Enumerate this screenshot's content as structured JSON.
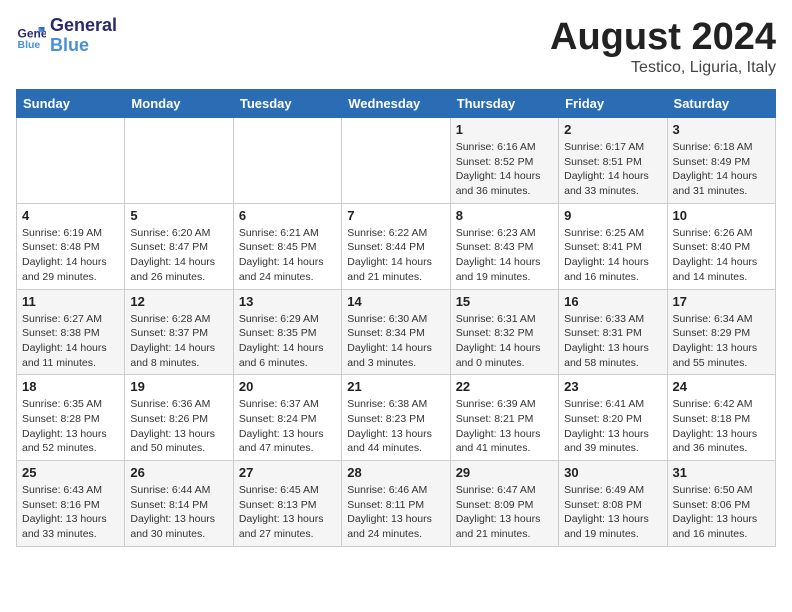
{
  "header": {
    "logo_line1": "General",
    "logo_line2": "Blue",
    "month_year": "August 2024",
    "location": "Testico, Liguria, Italy"
  },
  "weekdays": [
    "Sunday",
    "Monday",
    "Tuesday",
    "Wednesday",
    "Thursday",
    "Friday",
    "Saturday"
  ],
  "weeks": [
    [
      {
        "day": "",
        "info": ""
      },
      {
        "day": "",
        "info": ""
      },
      {
        "day": "",
        "info": ""
      },
      {
        "day": "",
        "info": ""
      },
      {
        "day": "1",
        "info": "Sunrise: 6:16 AM\nSunset: 8:52 PM\nDaylight: 14 hours and 36 minutes."
      },
      {
        "day": "2",
        "info": "Sunrise: 6:17 AM\nSunset: 8:51 PM\nDaylight: 14 hours and 33 minutes."
      },
      {
        "day": "3",
        "info": "Sunrise: 6:18 AM\nSunset: 8:49 PM\nDaylight: 14 hours and 31 minutes."
      }
    ],
    [
      {
        "day": "4",
        "info": "Sunrise: 6:19 AM\nSunset: 8:48 PM\nDaylight: 14 hours and 29 minutes."
      },
      {
        "day": "5",
        "info": "Sunrise: 6:20 AM\nSunset: 8:47 PM\nDaylight: 14 hours and 26 minutes."
      },
      {
        "day": "6",
        "info": "Sunrise: 6:21 AM\nSunset: 8:45 PM\nDaylight: 14 hours and 24 minutes."
      },
      {
        "day": "7",
        "info": "Sunrise: 6:22 AM\nSunset: 8:44 PM\nDaylight: 14 hours and 21 minutes."
      },
      {
        "day": "8",
        "info": "Sunrise: 6:23 AM\nSunset: 8:43 PM\nDaylight: 14 hours and 19 minutes."
      },
      {
        "day": "9",
        "info": "Sunrise: 6:25 AM\nSunset: 8:41 PM\nDaylight: 14 hours and 16 minutes."
      },
      {
        "day": "10",
        "info": "Sunrise: 6:26 AM\nSunset: 8:40 PM\nDaylight: 14 hours and 14 minutes."
      }
    ],
    [
      {
        "day": "11",
        "info": "Sunrise: 6:27 AM\nSunset: 8:38 PM\nDaylight: 14 hours and 11 minutes."
      },
      {
        "day": "12",
        "info": "Sunrise: 6:28 AM\nSunset: 8:37 PM\nDaylight: 14 hours and 8 minutes."
      },
      {
        "day": "13",
        "info": "Sunrise: 6:29 AM\nSunset: 8:35 PM\nDaylight: 14 hours and 6 minutes."
      },
      {
        "day": "14",
        "info": "Sunrise: 6:30 AM\nSunset: 8:34 PM\nDaylight: 14 hours and 3 minutes."
      },
      {
        "day": "15",
        "info": "Sunrise: 6:31 AM\nSunset: 8:32 PM\nDaylight: 14 hours and 0 minutes."
      },
      {
        "day": "16",
        "info": "Sunrise: 6:33 AM\nSunset: 8:31 PM\nDaylight: 13 hours and 58 minutes."
      },
      {
        "day": "17",
        "info": "Sunrise: 6:34 AM\nSunset: 8:29 PM\nDaylight: 13 hours and 55 minutes."
      }
    ],
    [
      {
        "day": "18",
        "info": "Sunrise: 6:35 AM\nSunset: 8:28 PM\nDaylight: 13 hours and 52 minutes."
      },
      {
        "day": "19",
        "info": "Sunrise: 6:36 AM\nSunset: 8:26 PM\nDaylight: 13 hours and 50 minutes."
      },
      {
        "day": "20",
        "info": "Sunrise: 6:37 AM\nSunset: 8:24 PM\nDaylight: 13 hours and 47 minutes."
      },
      {
        "day": "21",
        "info": "Sunrise: 6:38 AM\nSunset: 8:23 PM\nDaylight: 13 hours and 44 minutes."
      },
      {
        "day": "22",
        "info": "Sunrise: 6:39 AM\nSunset: 8:21 PM\nDaylight: 13 hours and 41 minutes."
      },
      {
        "day": "23",
        "info": "Sunrise: 6:41 AM\nSunset: 8:20 PM\nDaylight: 13 hours and 39 minutes."
      },
      {
        "day": "24",
        "info": "Sunrise: 6:42 AM\nSunset: 8:18 PM\nDaylight: 13 hours and 36 minutes."
      }
    ],
    [
      {
        "day": "25",
        "info": "Sunrise: 6:43 AM\nSunset: 8:16 PM\nDaylight: 13 hours and 33 minutes."
      },
      {
        "day": "26",
        "info": "Sunrise: 6:44 AM\nSunset: 8:14 PM\nDaylight: 13 hours and 30 minutes."
      },
      {
        "day": "27",
        "info": "Sunrise: 6:45 AM\nSunset: 8:13 PM\nDaylight: 13 hours and 27 minutes."
      },
      {
        "day": "28",
        "info": "Sunrise: 6:46 AM\nSunset: 8:11 PM\nDaylight: 13 hours and 24 minutes."
      },
      {
        "day": "29",
        "info": "Sunrise: 6:47 AM\nSunset: 8:09 PM\nDaylight: 13 hours and 21 minutes."
      },
      {
        "day": "30",
        "info": "Sunrise: 6:49 AM\nSunset: 8:08 PM\nDaylight: 13 hours and 19 minutes."
      },
      {
        "day": "31",
        "info": "Sunrise: 6:50 AM\nSunset: 8:06 PM\nDaylight: 13 hours and 16 minutes."
      }
    ]
  ]
}
